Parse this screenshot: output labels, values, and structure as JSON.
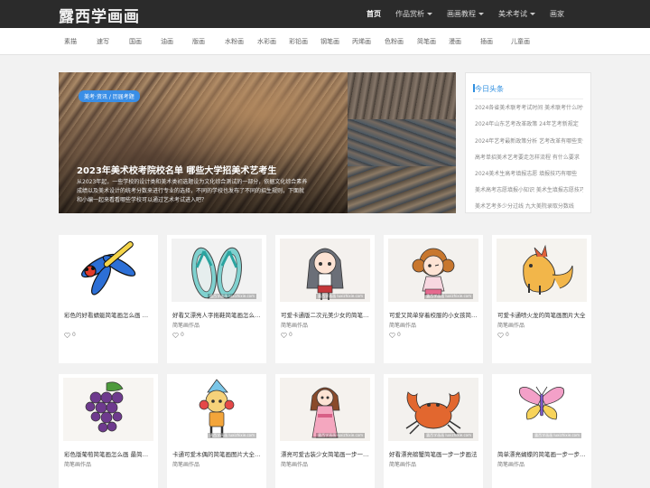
{
  "site": {
    "logo_text": "露西学画画"
  },
  "topnav": {
    "items": [
      {
        "label": "首页",
        "active": true,
        "dropdown": false
      },
      {
        "label": "作品赏析",
        "active": false,
        "dropdown": true
      },
      {
        "label": "画画教程",
        "active": false,
        "dropdown": true
      },
      {
        "label": "美术考试",
        "active": false,
        "dropdown": true
      },
      {
        "label": "画家",
        "active": false,
        "dropdown": false
      }
    ]
  },
  "subnav": {
    "items": [
      "素描",
      "速写",
      "国画",
      "油画",
      "版画",
      "水粉画",
      "水彩画",
      "彩铅画",
      "钢笔画",
      "丙烯画",
      "色粉画",
      "简笔画",
      "漫画",
      "插画",
      "儿童画"
    ]
  },
  "hero": {
    "tag": "美考·资讯 / 历届考题",
    "title": "2023年美术校考院校名单 哪些大学招美术艺考生",
    "desc_lines": [
      "从2023年起，一些学校的设计类和美术类初选题设为文化综合测试的一部分，依据文化综合素养",
      "成绩以及美术设计的统考分数来进行专业的选择，不同的学校也发布了不同的招生规则，下面就",
      "和小编一起来看看哪些学校可以通过艺术考试进入吧？"
    ]
  },
  "sidebar": {
    "title": "今日头条",
    "items": [
      "2024各省美术联考考试时间 美术联考什么时候",
      "2024年山东艺考改革政策 24年艺考新规定",
      "2024年艺考最新政策分析 艺考改革有哪些变化",
      "高考单招美术艺考要走怎样流程 有什么要求",
      "2024美术生高考填报志愿 填报技巧有哪些",
      "美术高考志愿填报小知识 美术生填报志愿技巧",
      "美术艺考多少分过线 九大美院录取分数线"
    ]
  },
  "cards": [
    {
      "title": "彩色的好看蜻蜓简笔画怎么画 蜻蜓画法",
      "category": "",
      "likes": "0",
      "watermark": "露西学画画 luxizhixie.com"
    },
    {
      "title": "好看又漂亮人字拖鞋简笔画怎么画步骤",
      "category": "简笔画作品",
      "likes": "0",
      "watermark": "露西学画画 luxizhixie.com"
    },
    {
      "title": "可爱卡通版二次元美少女的简笔画图片",
      "category": "简笔画作品",
      "likes": "0",
      "watermark": "露西学画画 luxizhixie.com"
    },
    {
      "title": "可爱又简单穿着校服的小女孩简笔画",
      "category": "简笔画作品",
      "likes": "0",
      "watermark": "露西学画画 luxizhixie.com"
    },
    {
      "title": "可爱卡通喷火龙的简笔画图片大全",
      "category": "简笔画作品",
      "likes": "0",
      "watermark": ""
    },
    {
      "title": "彩色版葡萄简笔画怎么画 最简单葡萄",
      "category": "简笔画作品",
      "likes": "",
      "watermark": ""
    },
    {
      "title": "卡通可爱木偶的简笔画图片大全 好看",
      "category": "简笔画作品",
      "likes": "",
      "watermark": "露西学画画 luxizhixie.com"
    },
    {
      "title": "漂亮可爱古装少女简笔画一步一步画",
      "category": "简笔画作品",
      "likes": "",
      "watermark": "露西学画画 luxizhixie.com"
    },
    {
      "title": "好看漂亮螃蟹简笔画一步一步画法",
      "category": "简笔画作品",
      "likes": "",
      "watermark": "露西学画画 luxizhixie.com"
    },
    {
      "title": "简单漂亮蝴蝶的简笔画一步一步教程",
      "category": "简笔画作品",
      "likes": "",
      "watermark": "露西学画画 luxizhixie.com"
    }
  ],
  "colors": {
    "accent": "#2f8fe0",
    "topbar": "#2b2b2b"
  }
}
